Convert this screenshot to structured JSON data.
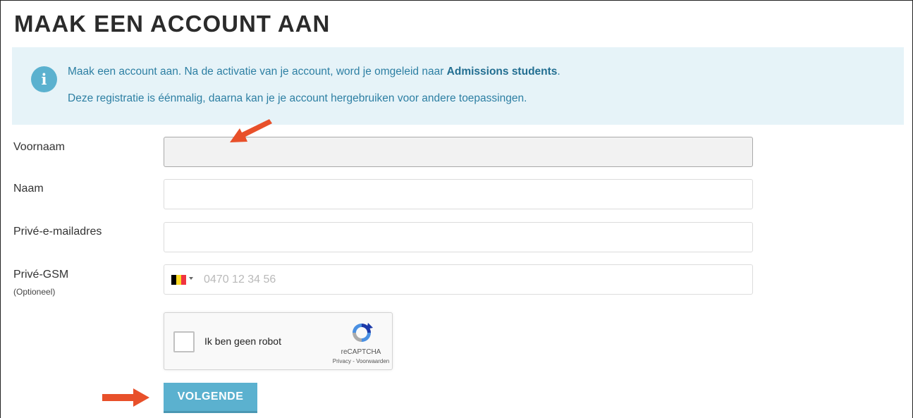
{
  "page": {
    "title": "MAAK EEN ACCOUNT AAN"
  },
  "info": {
    "line1_text": "Maak een account aan. Na de activatie van je account, word je omgeleid naar ",
    "line1_bold": "Admissions students",
    "line1_end": ".",
    "line2_text": "Deze registratie is éénmalig, daarna kan je je account hergebruiken voor andere toepassingen."
  },
  "form": {
    "firstname_label": "Voornaam",
    "firstname_value": "",
    "lastname_label": "Naam",
    "lastname_value": "",
    "email_label": "Privé-e-mailadres",
    "email_value": "",
    "phone_label": "Privé-GSM",
    "phone_sublabel": "(Optioneel)",
    "phone_placeholder": "0470 12 34 56",
    "phone_value": ""
  },
  "recaptcha": {
    "label": "Ik ben geen robot",
    "brand": "reCAPTCHA",
    "links": "Privacy - Voorwaarden"
  },
  "actions": {
    "next_label": "VOLGENDE"
  },
  "colors": {
    "accent": "#5bb1cf",
    "info_bg": "#e6f3f8",
    "info_text": "#2d7fa3",
    "annotation_arrow": "#e8502a",
    "flag_black": "#000000",
    "flag_yellow": "#fdda24",
    "flag_red": "#ef3340"
  },
  "icons": {
    "info": "info-icon",
    "flag": "belgium-flag-icon",
    "dropdown": "caret-down-icon",
    "recaptcha": "recaptcha-logo-icon",
    "annotation": "arrow-icon"
  }
}
